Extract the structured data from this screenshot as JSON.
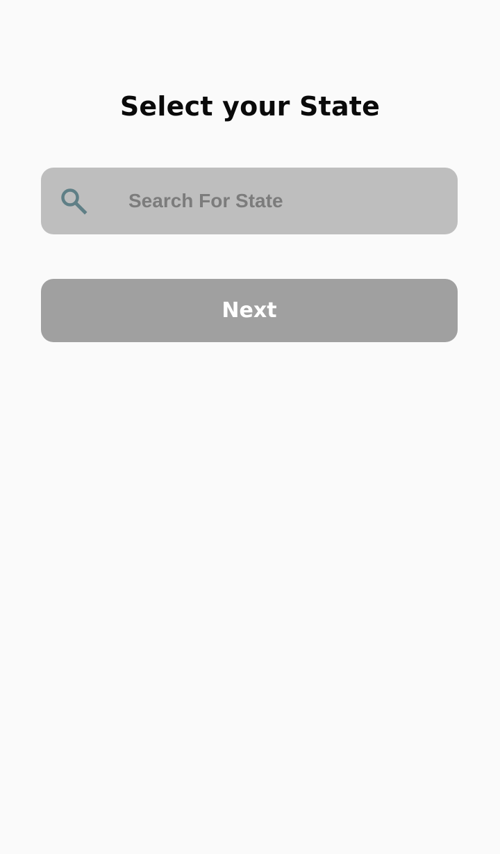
{
  "header": {
    "title": "Select your State"
  },
  "search": {
    "value": "",
    "placeholder": "Search For State",
    "icon": "search-icon"
  },
  "actions": {
    "next_label": "Next"
  },
  "colors": {
    "background": "#fafafa",
    "title_text": "#0a0a0a",
    "search_background": "#bebebe",
    "search_icon": "#5f7f86",
    "placeholder_text": "#7c7c7c",
    "button_disabled_background": "#a0a0a0",
    "button_text": "#ffffff"
  }
}
